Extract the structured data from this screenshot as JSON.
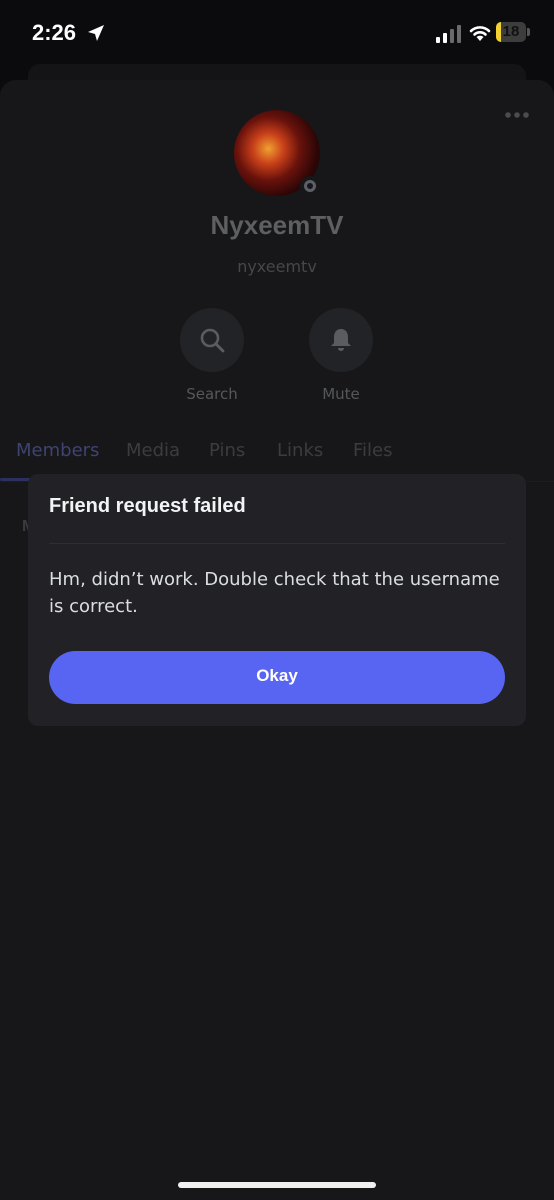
{
  "status_bar": {
    "time": "2:26",
    "location_icon": "location-arrow-icon",
    "signal_icon": "cellular-signal-icon",
    "wifi_icon": "wifi-icon",
    "battery_level": "18",
    "battery_fraction": 0.18,
    "battery_color": "#f2d130"
  },
  "profile": {
    "display_name": "NyxeemTV",
    "username": "nyxeemtv",
    "more_icon": "more-dots-icon",
    "actions": [
      {
        "label": "Search",
        "icon": "search-icon"
      },
      {
        "label": "Mute",
        "icon": "bell-icon"
      }
    ]
  },
  "tabs": [
    {
      "label": "Members",
      "active": true
    },
    {
      "label": "Media",
      "active": false
    },
    {
      "label": "Pins",
      "active": false
    },
    {
      "label": "Links",
      "active": false
    },
    {
      "label": "Files",
      "active": false
    }
  ],
  "list_partial_letter": "M",
  "dialog": {
    "title": "Friend request failed",
    "message": "Hm, didn’t work. Double check that the username is correct.",
    "button_label": "Okay",
    "button_color": "#5865f2"
  }
}
